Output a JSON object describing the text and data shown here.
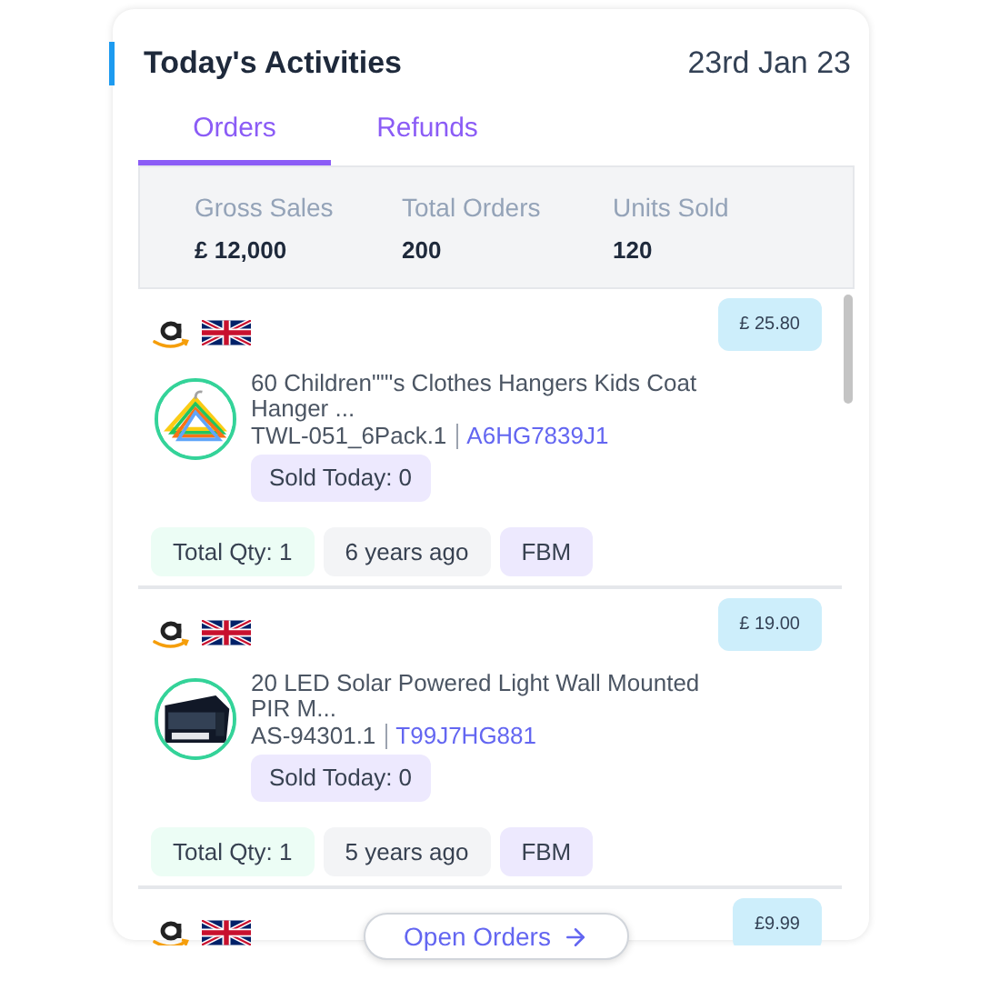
{
  "header": {
    "title": "Today's Activities",
    "date": "23rd Jan 23"
  },
  "tabs": [
    {
      "label": "Orders",
      "selected": true
    },
    {
      "label": "Refunds",
      "selected": false
    }
  ],
  "stats": [
    {
      "label": "Gross Sales",
      "value": "£ 12,000"
    },
    {
      "label": "Total Orders",
      "value": "200"
    },
    {
      "label": "Units Sold",
      "value": "120"
    }
  ],
  "orders": [
    {
      "price": "£ 25.80",
      "title": "60 Children\"\"'s Clothes Hangers Kids Coat Hanger ...",
      "sku": "TWL-051_6Pack.1",
      "asin": "A6HG7839J1",
      "sold_today": "Sold Today: 0",
      "total_qty": "Total Qty: 1",
      "age": "6 years ago",
      "channel": "FBM"
    },
    {
      "price": "£ 19.00",
      "title": "20 LED Solar Powered Light Wall Mounted PIR M...",
      "sku": "AS-94301.1",
      "asin": "T99J7HG881",
      "sold_today": "Sold Today: 0",
      "total_qty": "Total Qty: 1",
      "age": "5 years ago",
      "channel": "FBM"
    },
    {
      "price": "£9.99"
    }
  ],
  "open_button": {
    "label": "Open Orders"
  }
}
